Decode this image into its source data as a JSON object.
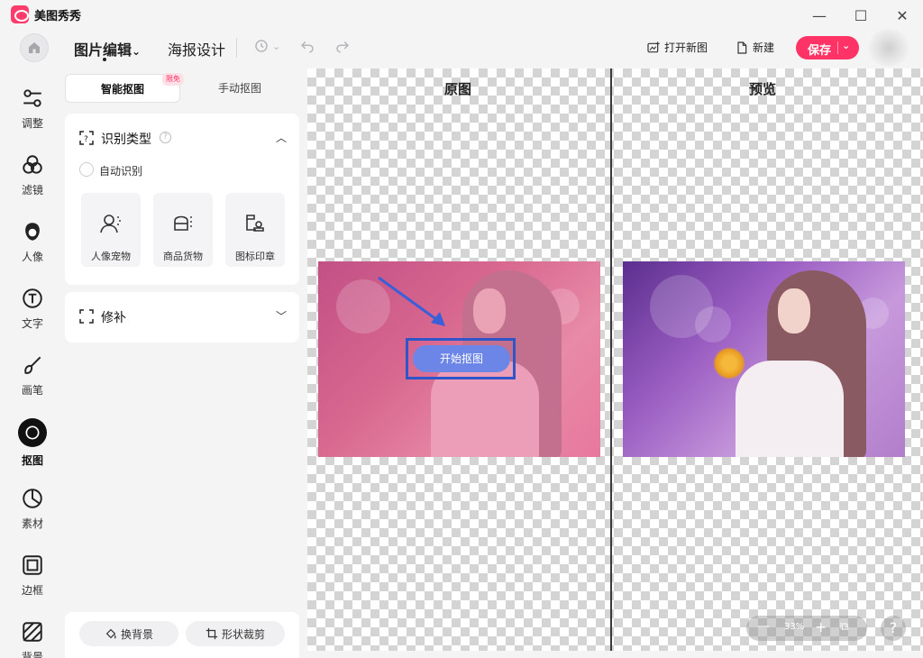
{
  "app": {
    "title": "美图秀秀"
  },
  "window": {
    "minimize": "—",
    "maximize": "☐",
    "close": "✕"
  },
  "toolbar": {
    "tab_image_edit": "图片编辑",
    "tab_image_edit_arrow": "⌄",
    "tab_poster": "海报设计",
    "open_new": "打开新图",
    "new": "新建",
    "save": "保存",
    "save_arrow": "⌄"
  },
  "nav": {
    "items": [
      {
        "label": "调整",
        "icon": "sliders-icon"
      },
      {
        "label": "滤镜",
        "icon": "filter-circles-icon"
      },
      {
        "label": "人像",
        "icon": "portrait-icon"
      },
      {
        "label": "文字",
        "icon": "text-icon"
      },
      {
        "label": "画笔",
        "icon": "brush-icon"
      },
      {
        "label": "抠图",
        "icon": "cutout-icon",
        "active": true
      },
      {
        "label": "素材",
        "icon": "sticker-icon"
      },
      {
        "label": "边框",
        "icon": "frame-icon"
      },
      {
        "label": "背景",
        "icon": "background-icon"
      }
    ]
  },
  "panel": {
    "seg_smart": "智能抠图",
    "seg_badge": "限免",
    "seg_manual": "手动抠图",
    "recognition": {
      "title": "识别类型",
      "help": "?",
      "auto_label": "自动识别",
      "types": [
        {
          "label": "人像宠物",
          "icon": "person-pet-icon"
        },
        {
          "label": "商品货物",
          "icon": "product-icon"
        },
        {
          "label": "图标印章",
          "icon": "stamp-icon"
        }
      ]
    },
    "repair": {
      "title": "修补"
    },
    "bottom": {
      "change_bg": "换背景",
      "shape_crop": "形状裁剪"
    }
  },
  "canvas": {
    "original_title": "原图",
    "preview_title": "预览",
    "start_cutout": "开始抠图",
    "zoom": {
      "minus": "—",
      "level": "33%",
      "plus": "+",
      "fit": "⧉"
    },
    "help": "?"
  },
  "colors": {
    "accent": "#ff3366",
    "start_button": "#6b86e6",
    "highlight_frame": "#2f56c8"
  }
}
